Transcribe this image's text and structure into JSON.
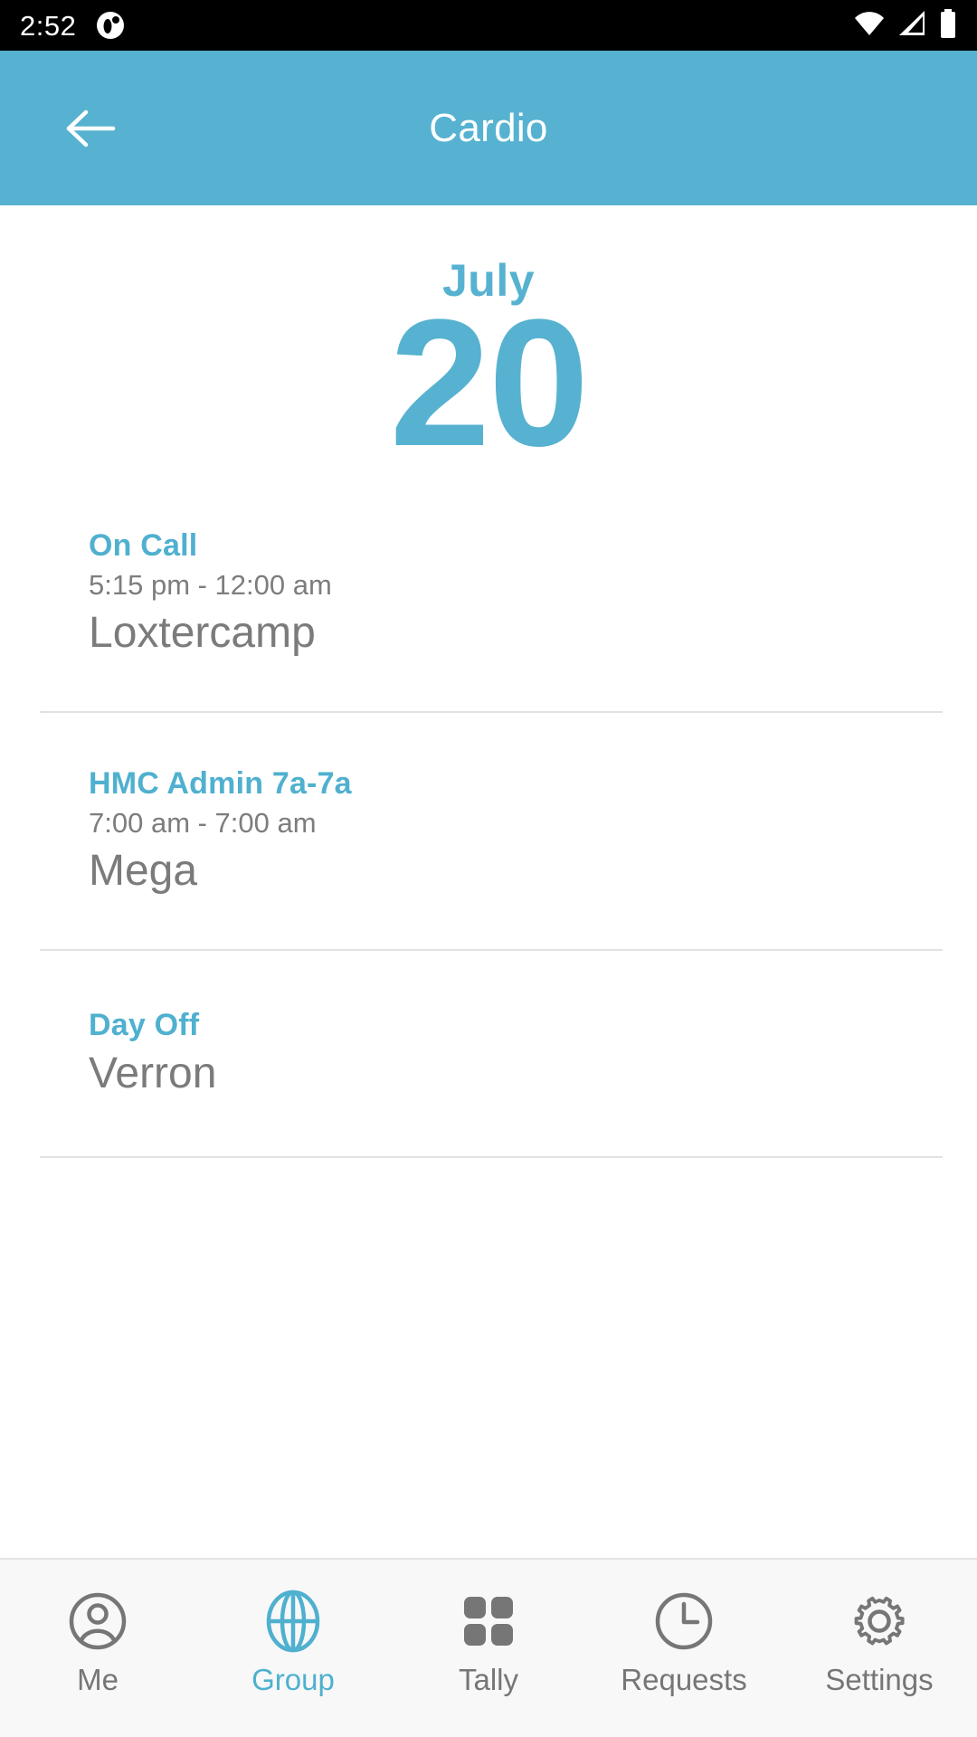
{
  "status_bar": {
    "time": "2:52",
    "notification_icon": "notification-dot-icon",
    "wifi_icon": "wifi-icon",
    "signal_icon": "cellular-signal-icon",
    "battery_icon": "battery-full-icon",
    "background_color": "#000000",
    "foreground_color": "#ffffff"
  },
  "app_bar": {
    "title": "Cardio",
    "back_icon": "arrow-left-icon",
    "background_color": "#56b2d0",
    "text_color": "#ffffff"
  },
  "date": {
    "month": "July",
    "day": "20",
    "color": "#56b2d0"
  },
  "entries": [
    {
      "title": "On Call",
      "time": "5:15 pm - 12:00 am",
      "name": "Loxtercamp"
    },
    {
      "title": "HMC Admin 7a-7a",
      "time": "7:00 am - 7:00 am",
      "name": "Mega"
    },
    {
      "title": "Day Off",
      "time": "",
      "name": "Verron"
    }
  ],
  "bottom_nav": {
    "active_color": "#4fb0cf",
    "inactive_color": "#767676",
    "items": [
      {
        "label": "Me",
        "icon": "person-circle-icon",
        "active": false
      },
      {
        "label": "Group",
        "icon": "globe-icon",
        "active": true
      },
      {
        "label": "Tally",
        "icon": "grid-squares-icon",
        "active": false
      },
      {
        "label": "Requests",
        "icon": "clock-icon",
        "active": false
      },
      {
        "label": "Settings",
        "icon": "gear-icon",
        "active": false
      }
    ]
  }
}
